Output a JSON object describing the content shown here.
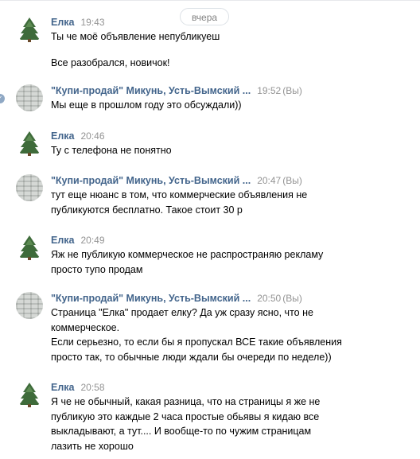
{
  "date_divider": "вчера",
  "messages": [
    {
      "author": "Елка",
      "time": "19:43",
      "you": "",
      "avatar": "tree-avatar",
      "lines": [
        "Ты че моё объявление непубликуеш"
      ],
      "extra": [
        "Все разобрался, новичок!"
      ]
    },
    {
      "author": "\"Купи-продай\" Микунь, Усть-Вымский ...",
      "time": "19:52",
      "you": "(Вы)",
      "avatar": "group-avatar",
      "lines": [
        "Мы еще в прошлом году это обсуждали))"
      ]
    },
    {
      "author": "Елка",
      "time": "20:46",
      "you": "",
      "avatar": "tree-avatar",
      "lines": [
        "Ту с телефона не понятно"
      ]
    },
    {
      "author": "\"Купи-продай\" Микунь, Усть-Вымский ...",
      "time": "20:47",
      "you": "(Вы)",
      "avatar": "group-avatar",
      "lines": [
        "тут еще нюанс в том, что коммерческие объявления не",
        "публикуются бесплатно. Такое стоит 30 р"
      ]
    },
    {
      "author": "Елка",
      "time": "20:49",
      "you": "",
      "avatar": "tree-avatar",
      "lines": [
        "Яж не публикую коммерческое не распространяю рекламу",
        "просто тупо продам"
      ]
    },
    {
      "author": "\"Купи-продай\" Микунь, Усть-Вымский ...",
      "time": "20:50",
      "you": "(Вы)",
      "avatar": "group-avatar",
      "lines": [
        "Страница \"Елка\" продает елку? Да уж сразу ясно, что не",
        "коммерческое.",
        "Если серьезно, то если бы я пропускал ВСЕ такие объявления",
        "просто так, то обычные люди ждали бы очереди по неделе))"
      ]
    },
    {
      "author": "Елка",
      "time": "20:58",
      "you": "",
      "avatar": "tree-avatar",
      "lines": [
        "Я че не обычный, какая разница, что на страницы я же не",
        "публикую это каждые 2 часа простые обьявы я кидаю все",
        "выкладывают, а тут.... И вообще-то по чужим страницам",
        "лазить не хорошо"
      ]
    }
  ]
}
